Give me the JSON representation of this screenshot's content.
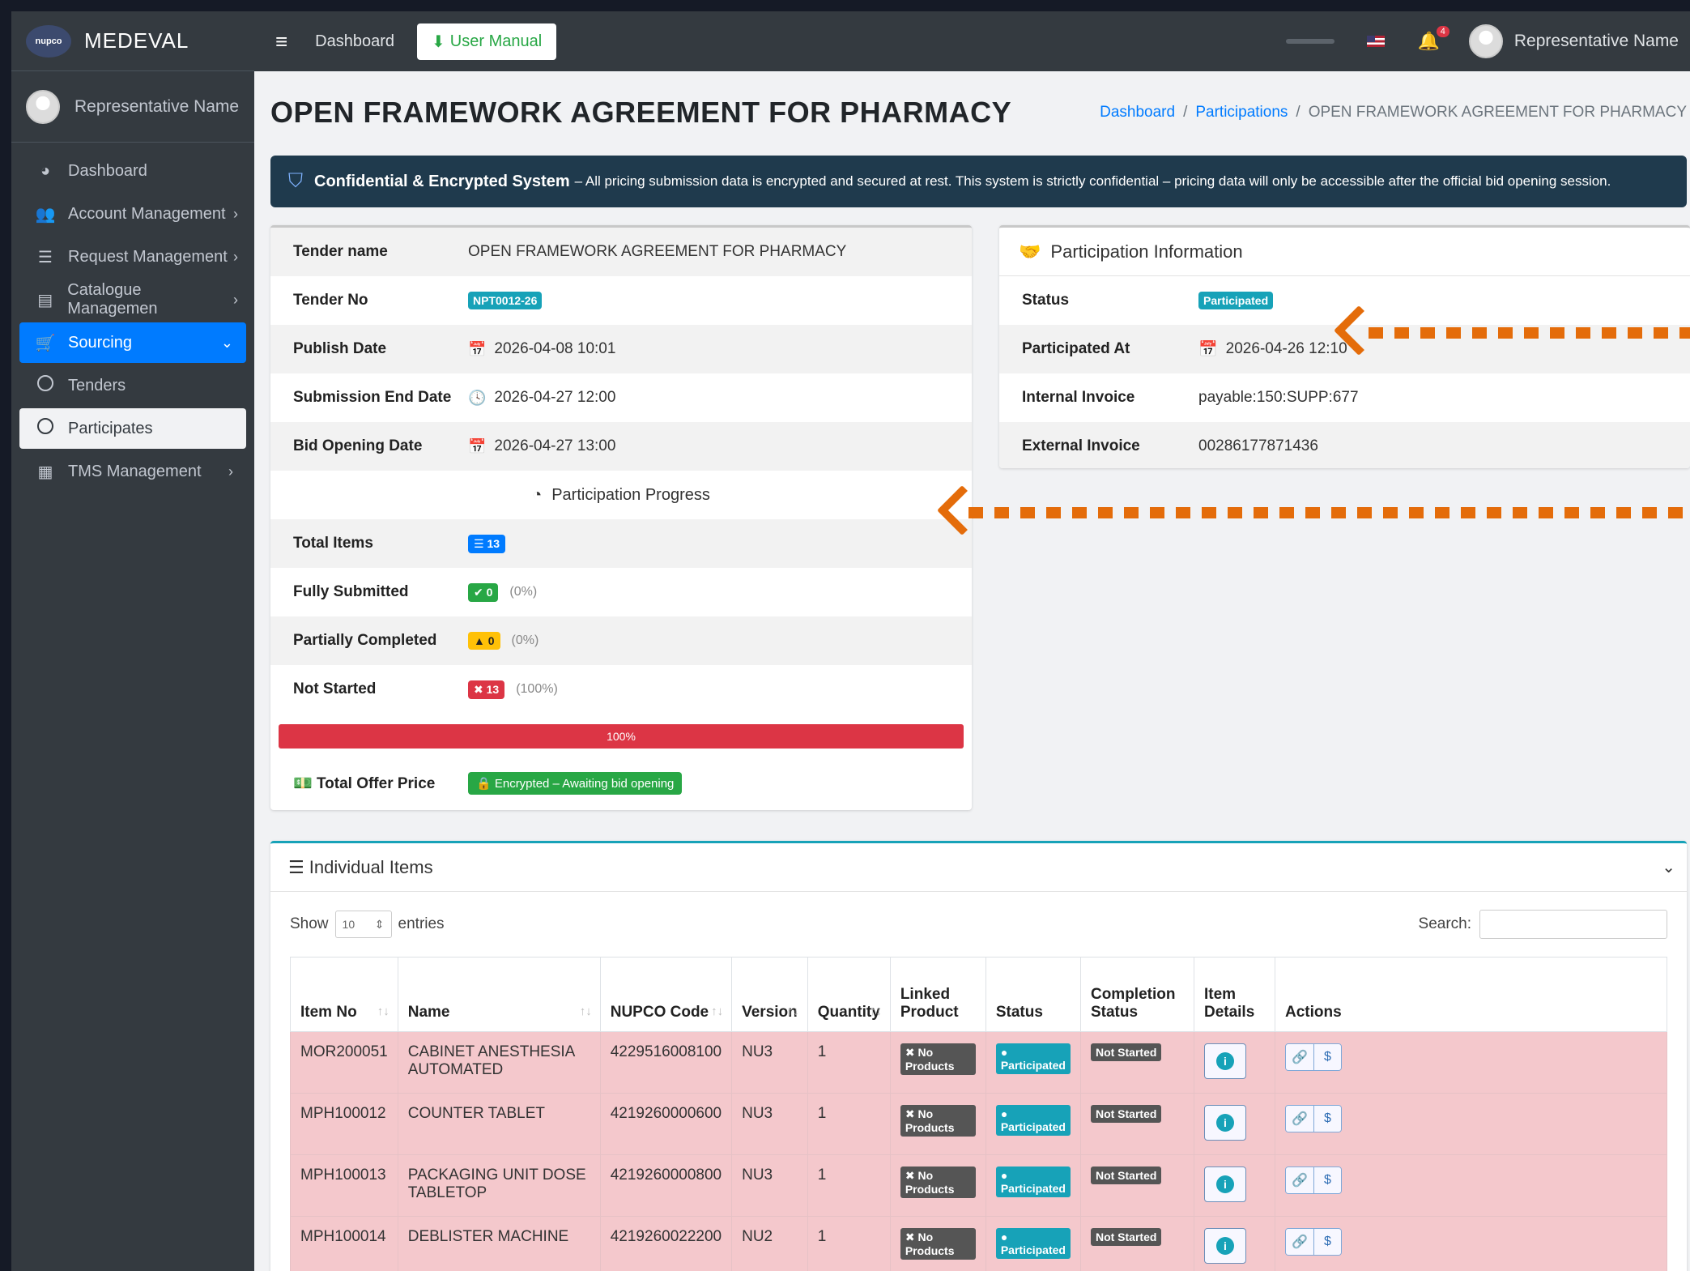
{
  "brand": {
    "name": "MEDEVAL",
    "logo_text": "nupco"
  },
  "user": {
    "name": "Representative Name"
  },
  "sidebar": {
    "items": [
      {
        "label": "Dashboard",
        "icon": "tachometer-icon"
      },
      {
        "label": "Account Management",
        "icon": "users-cog-icon"
      },
      {
        "label": "Request Management",
        "icon": "list-icon"
      },
      {
        "label": "Catalogue Managemen",
        "icon": "book-icon"
      },
      {
        "label": "Sourcing",
        "icon": "cart-icon"
      },
      {
        "label": "Tenders",
        "icon": "circle-icon"
      },
      {
        "label": "Participates",
        "icon": "circle-icon"
      },
      {
        "label": "TMS Management",
        "icon": "grid-icon"
      }
    ]
  },
  "topbar": {
    "dashboard": "Dashboard",
    "user_manual": "User Manual",
    "notif_count": "4"
  },
  "page": {
    "title": "OPEN FRAMEWORK AGREEMENT FOR PHARMACY",
    "breadcrumb": [
      "Dashboard",
      "Participations",
      "OPEN FRAMEWORK AGREEMENT FOR PHARMACY"
    ]
  },
  "alert": {
    "strong": "Confidential & Encrypted System",
    "text": "– All pricing submission data is encrypted and secured at rest. This system is strictly confidential – pricing data will only be accessible after the official bid opening session."
  },
  "tender": {
    "rows": [
      {
        "label": "Tender name",
        "value": "OPEN FRAMEWORK AGREEMENT FOR PHARMACY"
      },
      {
        "label": "Tender No",
        "value": "NPT0012-26"
      },
      {
        "label": "Publish Date",
        "value": "2026-04-08 10:01"
      },
      {
        "label": "Submission End Date",
        "value": "2026-04-27 12:00"
      },
      {
        "label": "Bid Opening Date",
        "value": "2026-04-27 13:00"
      }
    ],
    "progress_title": "Participation Progress",
    "stats": [
      {
        "label": "Total Items",
        "value": "13",
        "pct": ""
      },
      {
        "label": "Fully Submitted",
        "value": "0",
        "pct": "(0%)"
      },
      {
        "label": "Partially Completed",
        "value": "0",
        "pct": "(0%)"
      },
      {
        "label": "Not Started",
        "value": "13",
        "pct": "(100%)"
      }
    ],
    "progress_label": "100%",
    "progress_fraction": 1.0,
    "offer_label": "Total Offer Price",
    "offer_value": "🔒 Encrypted – Awaiting bid opening"
  },
  "participation": {
    "title": "Participation Information",
    "rows": [
      {
        "label": "Status",
        "value": "Participated"
      },
      {
        "label": "Participated At",
        "value": "2026-04-26 12:10"
      },
      {
        "label": "Internal Invoice",
        "value": "payable:150:SUPP:677"
      },
      {
        "label": "External Invoice",
        "value": "00286177871436"
      }
    ]
  },
  "items": {
    "title": "Individual Items",
    "show": "Show",
    "entries_value": "10",
    "entries": "entries",
    "search": "Search:",
    "columns": [
      "Item No",
      "Name",
      "NUPCO Code",
      "Version",
      "Quantity",
      "Linked Product",
      "Status",
      "Completion Status",
      "Item Details",
      "Actions"
    ],
    "rows": [
      {
        "item_no": "MOR200051",
        "name": "CABINET ANESTHESIA AUTOMATED",
        "code": "4229516008100",
        "version": "NU3",
        "qty": "1",
        "linked": "No Products",
        "status": "Participated",
        "completion": "Not Started"
      },
      {
        "item_no": "MPH100012",
        "name": "COUNTER TABLET",
        "code": "4219260000600",
        "version": "NU3",
        "qty": "1",
        "linked": "No Products",
        "status": "Participated",
        "completion": "Not Started"
      },
      {
        "item_no": "MPH100013",
        "name": "PACKAGING UNIT DOSE TABLETOP",
        "code": "4219260000800",
        "version": "NU3",
        "qty": "1",
        "linked": "No Products",
        "status": "Participated",
        "completion": "Not Started"
      },
      {
        "item_no": "MPH100014",
        "name": "DEBLISTER MACHINE",
        "code": "4219260022200",
        "version": "NU2",
        "qty": "1",
        "linked": "No Products",
        "status": "Participated",
        "completion": "Not Started"
      }
    ]
  },
  "colors": {
    "accent": "#007bff",
    "sidebar": "#343a40",
    "annotation_arrow": "#e46c0a",
    "danger": "#dc3545",
    "success": "#28a745"
  }
}
